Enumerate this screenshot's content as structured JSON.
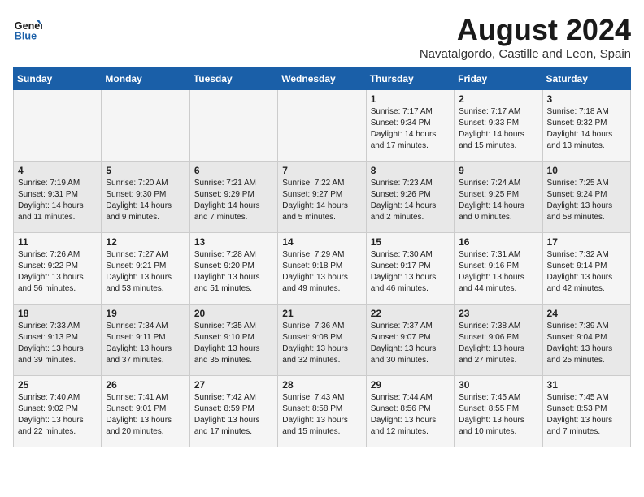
{
  "logo": {
    "line1": "General",
    "line2": "Blue"
  },
  "title": "August 2024",
  "location": "Navatalgordo, Castille and Leon, Spain",
  "days_of_week": [
    "Sunday",
    "Monday",
    "Tuesday",
    "Wednesday",
    "Thursday",
    "Friday",
    "Saturday"
  ],
  "weeks": [
    [
      {
        "day": "",
        "info": ""
      },
      {
        "day": "",
        "info": ""
      },
      {
        "day": "",
        "info": ""
      },
      {
        "day": "",
        "info": ""
      },
      {
        "day": "1",
        "info": "Sunrise: 7:17 AM\nSunset: 9:34 PM\nDaylight: 14 hours and 17 minutes."
      },
      {
        "day": "2",
        "info": "Sunrise: 7:17 AM\nSunset: 9:33 PM\nDaylight: 14 hours and 15 minutes."
      },
      {
        "day": "3",
        "info": "Sunrise: 7:18 AM\nSunset: 9:32 PM\nDaylight: 14 hours and 13 minutes."
      }
    ],
    [
      {
        "day": "4",
        "info": "Sunrise: 7:19 AM\nSunset: 9:31 PM\nDaylight: 14 hours and 11 minutes."
      },
      {
        "day": "5",
        "info": "Sunrise: 7:20 AM\nSunset: 9:30 PM\nDaylight: 14 hours and 9 minutes."
      },
      {
        "day": "6",
        "info": "Sunrise: 7:21 AM\nSunset: 9:29 PM\nDaylight: 14 hours and 7 minutes."
      },
      {
        "day": "7",
        "info": "Sunrise: 7:22 AM\nSunset: 9:27 PM\nDaylight: 14 hours and 5 minutes."
      },
      {
        "day": "8",
        "info": "Sunrise: 7:23 AM\nSunset: 9:26 PM\nDaylight: 14 hours and 2 minutes."
      },
      {
        "day": "9",
        "info": "Sunrise: 7:24 AM\nSunset: 9:25 PM\nDaylight: 14 hours and 0 minutes."
      },
      {
        "day": "10",
        "info": "Sunrise: 7:25 AM\nSunset: 9:24 PM\nDaylight: 13 hours and 58 minutes."
      }
    ],
    [
      {
        "day": "11",
        "info": "Sunrise: 7:26 AM\nSunset: 9:22 PM\nDaylight: 13 hours and 56 minutes."
      },
      {
        "day": "12",
        "info": "Sunrise: 7:27 AM\nSunset: 9:21 PM\nDaylight: 13 hours and 53 minutes."
      },
      {
        "day": "13",
        "info": "Sunrise: 7:28 AM\nSunset: 9:20 PM\nDaylight: 13 hours and 51 minutes."
      },
      {
        "day": "14",
        "info": "Sunrise: 7:29 AM\nSunset: 9:18 PM\nDaylight: 13 hours and 49 minutes."
      },
      {
        "day": "15",
        "info": "Sunrise: 7:30 AM\nSunset: 9:17 PM\nDaylight: 13 hours and 46 minutes."
      },
      {
        "day": "16",
        "info": "Sunrise: 7:31 AM\nSunset: 9:16 PM\nDaylight: 13 hours and 44 minutes."
      },
      {
        "day": "17",
        "info": "Sunrise: 7:32 AM\nSunset: 9:14 PM\nDaylight: 13 hours and 42 minutes."
      }
    ],
    [
      {
        "day": "18",
        "info": "Sunrise: 7:33 AM\nSunset: 9:13 PM\nDaylight: 13 hours and 39 minutes."
      },
      {
        "day": "19",
        "info": "Sunrise: 7:34 AM\nSunset: 9:11 PM\nDaylight: 13 hours and 37 minutes."
      },
      {
        "day": "20",
        "info": "Sunrise: 7:35 AM\nSunset: 9:10 PM\nDaylight: 13 hours and 35 minutes."
      },
      {
        "day": "21",
        "info": "Sunrise: 7:36 AM\nSunset: 9:08 PM\nDaylight: 13 hours and 32 minutes."
      },
      {
        "day": "22",
        "info": "Sunrise: 7:37 AM\nSunset: 9:07 PM\nDaylight: 13 hours and 30 minutes."
      },
      {
        "day": "23",
        "info": "Sunrise: 7:38 AM\nSunset: 9:06 PM\nDaylight: 13 hours and 27 minutes."
      },
      {
        "day": "24",
        "info": "Sunrise: 7:39 AM\nSunset: 9:04 PM\nDaylight: 13 hours and 25 minutes."
      }
    ],
    [
      {
        "day": "25",
        "info": "Sunrise: 7:40 AM\nSunset: 9:02 PM\nDaylight: 13 hours and 22 minutes."
      },
      {
        "day": "26",
        "info": "Sunrise: 7:41 AM\nSunset: 9:01 PM\nDaylight: 13 hours and 20 minutes."
      },
      {
        "day": "27",
        "info": "Sunrise: 7:42 AM\nSunset: 8:59 PM\nDaylight: 13 hours and 17 minutes."
      },
      {
        "day": "28",
        "info": "Sunrise: 7:43 AM\nSunset: 8:58 PM\nDaylight: 13 hours and 15 minutes."
      },
      {
        "day": "29",
        "info": "Sunrise: 7:44 AM\nSunset: 8:56 PM\nDaylight: 13 hours and 12 minutes."
      },
      {
        "day": "30",
        "info": "Sunrise: 7:45 AM\nSunset: 8:55 PM\nDaylight: 13 hours and 10 minutes."
      },
      {
        "day": "31",
        "info": "Sunrise: 7:45 AM\nSunset: 8:53 PM\nDaylight: 13 hours and 7 minutes."
      }
    ]
  ]
}
